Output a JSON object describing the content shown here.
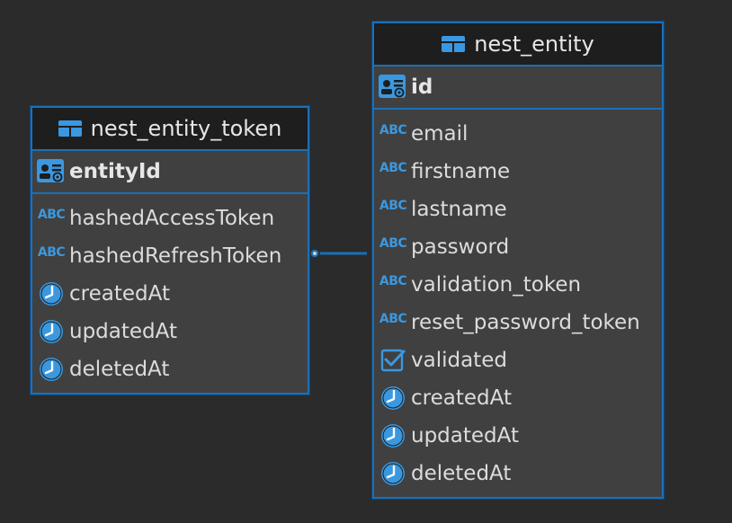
{
  "tables": {
    "token": {
      "name": "nest_entity_token",
      "pk": "entityId",
      "columns": [
        {
          "name": "hashedAccessToken",
          "type_icon": "abc-icon"
        },
        {
          "name": "hashedRefreshToken",
          "type_icon": "abc-icon"
        },
        {
          "name": "createdAt",
          "type_icon": "clock-icon"
        },
        {
          "name": "updatedAt",
          "type_icon": "clock-icon"
        },
        {
          "name": "deletedAt",
          "type_icon": "clock-icon"
        }
      ]
    },
    "entity": {
      "name": "nest_entity",
      "pk": "id",
      "columns": [
        {
          "name": "email",
          "type_icon": "abc-icon"
        },
        {
          "name": "firstname",
          "type_icon": "abc-icon"
        },
        {
          "name": "lastname",
          "type_icon": "abc-icon"
        },
        {
          "name": "password",
          "type_icon": "abc-icon"
        },
        {
          "name": "validation_token",
          "type_icon": "abc-icon"
        },
        {
          "name": "reset_password_token",
          "type_icon": "abc-icon"
        },
        {
          "name": "validated",
          "type_icon": "checkbox-icon"
        },
        {
          "name": "createdAt",
          "type_icon": "clock-icon"
        },
        {
          "name": "updatedAt",
          "type_icon": "clock-icon"
        },
        {
          "name": "deletedAt",
          "type_icon": "clock-icon"
        }
      ]
    }
  },
  "icons": {
    "abc_text": "ABC"
  },
  "colors": {
    "background": "#2b2b2b",
    "border": "#1a70b8",
    "accent": "#3a98e0",
    "header_bg": "#1e1e1e",
    "body_bg": "#404040"
  }
}
